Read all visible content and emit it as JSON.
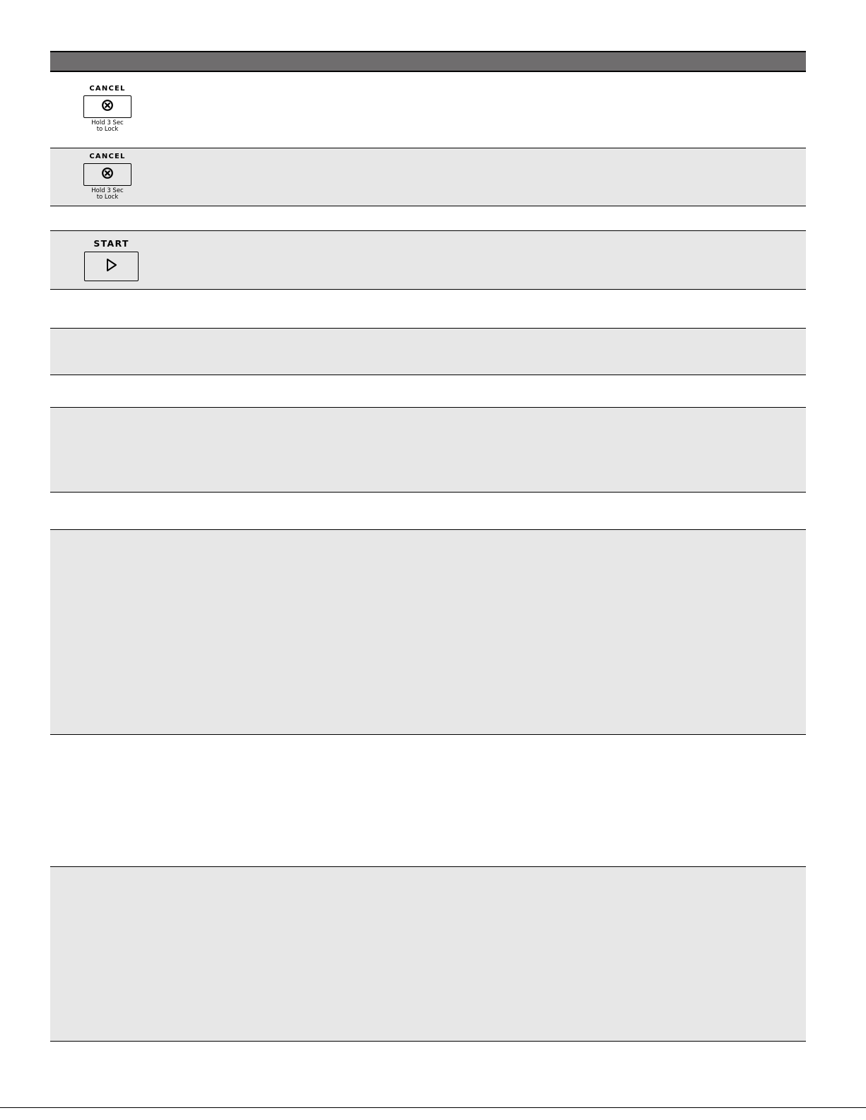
{
  "colors": {
    "header_bar": "#6f6d6e",
    "shaded_row": "#e7e7e7",
    "rule": "#000000"
  },
  "keys": {
    "cancel": {
      "label": "CANCEL",
      "icon": "cancel-x-icon",
      "caption_line1": "Hold 3 Sec",
      "caption_line2": "to Lock"
    },
    "start": {
      "label": "START",
      "icon": "play-icon"
    }
  }
}
